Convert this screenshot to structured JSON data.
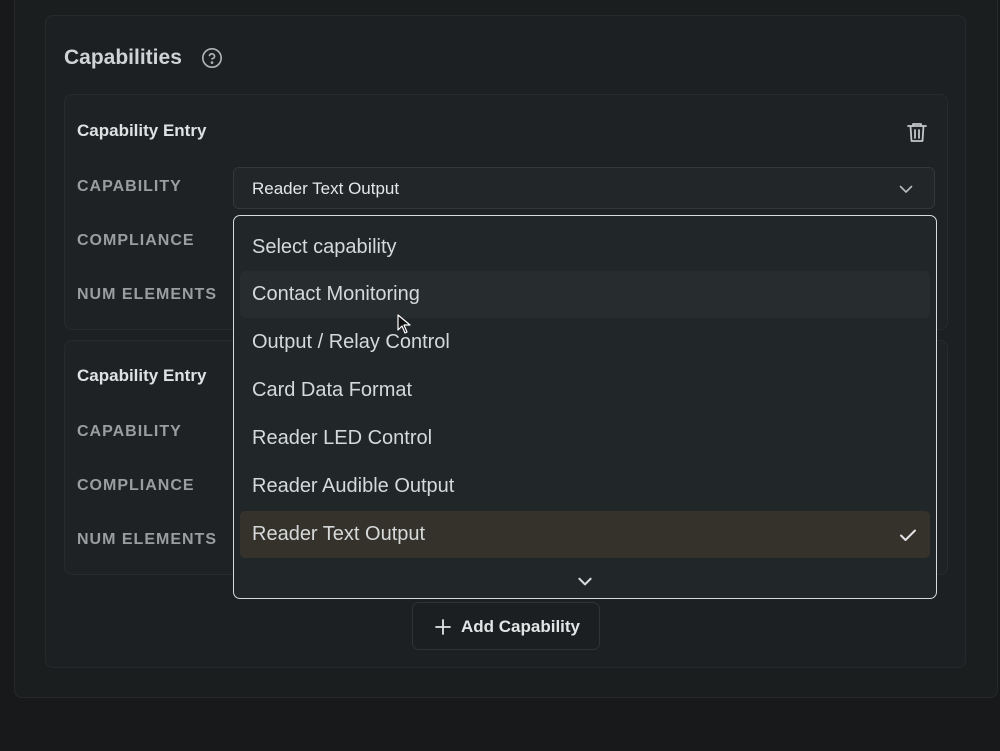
{
  "section": {
    "title": "Capabilities"
  },
  "entries": [
    {
      "title": "Capability Entry",
      "labels": {
        "capability": "CAPABILITY",
        "compliance": "COMPLIANCE",
        "num_elements": "NUM ELEMENTS"
      },
      "capability_value": "Reader Text Output"
    },
    {
      "title": "Capability Entry",
      "labels": {
        "capability": "CAPABILITY",
        "compliance": "COMPLIANCE",
        "num_elements": "NUM ELEMENTS"
      }
    }
  ],
  "dropdown": {
    "options": [
      {
        "label": "Select capability"
      },
      {
        "label": "Contact Monitoring",
        "state": "hover"
      },
      {
        "label": "Output / Relay Control"
      },
      {
        "label": "Card Data Format"
      },
      {
        "label": "Reader LED Control"
      },
      {
        "label": "Reader Audible Output"
      },
      {
        "label": "Reader Text Output",
        "state": "selected"
      }
    ]
  },
  "add_button": {
    "label": "Add Capability"
  },
  "icons": {
    "help": "help-circle-icon",
    "trash": "trash-icon",
    "chevron": "chevron-down-icon",
    "check": "check-icon",
    "plus": "plus-icon"
  },
  "colors": {
    "background": "#17191a",
    "panel": "#1d2022",
    "dropdown_border": "#d8dadb",
    "selected_option": "#35322c",
    "hover_option": "#272c2e"
  }
}
